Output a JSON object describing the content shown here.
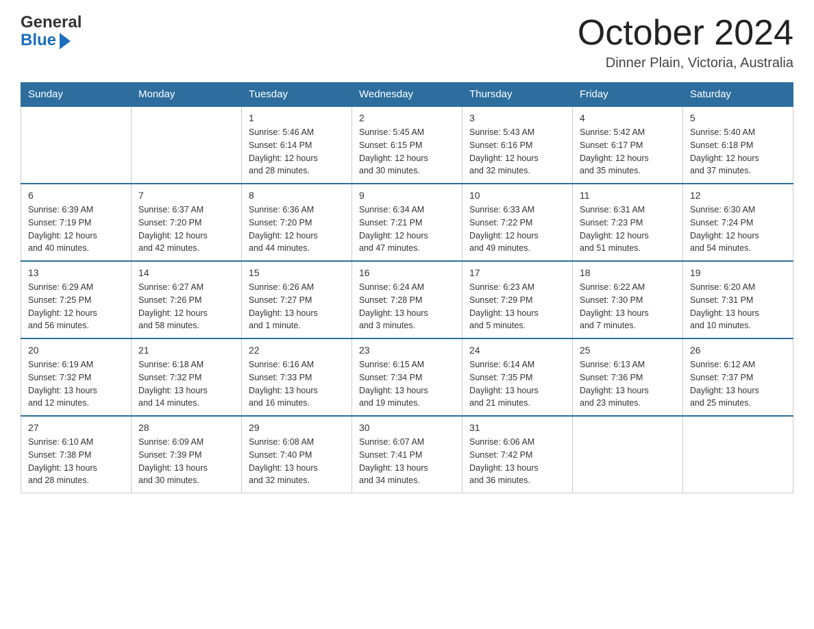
{
  "logo": {
    "text_general": "General",
    "text_blue": "Blue",
    "arrow": "▶"
  },
  "title": "October 2024",
  "location": "Dinner Plain, Victoria, Australia",
  "headers": [
    "Sunday",
    "Monday",
    "Tuesday",
    "Wednesday",
    "Thursday",
    "Friday",
    "Saturday"
  ],
  "weeks": [
    [
      {
        "day": "",
        "info": ""
      },
      {
        "day": "",
        "info": ""
      },
      {
        "day": "1",
        "info": "Sunrise: 5:46 AM\nSunset: 6:14 PM\nDaylight: 12 hours\nand 28 minutes."
      },
      {
        "day": "2",
        "info": "Sunrise: 5:45 AM\nSunset: 6:15 PM\nDaylight: 12 hours\nand 30 minutes."
      },
      {
        "day": "3",
        "info": "Sunrise: 5:43 AM\nSunset: 6:16 PM\nDaylight: 12 hours\nand 32 minutes."
      },
      {
        "day": "4",
        "info": "Sunrise: 5:42 AM\nSunset: 6:17 PM\nDaylight: 12 hours\nand 35 minutes."
      },
      {
        "day": "5",
        "info": "Sunrise: 5:40 AM\nSunset: 6:18 PM\nDaylight: 12 hours\nand 37 minutes."
      }
    ],
    [
      {
        "day": "6",
        "info": "Sunrise: 6:39 AM\nSunset: 7:19 PM\nDaylight: 12 hours\nand 40 minutes."
      },
      {
        "day": "7",
        "info": "Sunrise: 6:37 AM\nSunset: 7:20 PM\nDaylight: 12 hours\nand 42 minutes."
      },
      {
        "day": "8",
        "info": "Sunrise: 6:36 AM\nSunset: 7:20 PM\nDaylight: 12 hours\nand 44 minutes."
      },
      {
        "day": "9",
        "info": "Sunrise: 6:34 AM\nSunset: 7:21 PM\nDaylight: 12 hours\nand 47 minutes."
      },
      {
        "day": "10",
        "info": "Sunrise: 6:33 AM\nSunset: 7:22 PM\nDaylight: 12 hours\nand 49 minutes."
      },
      {
        "day": "11",
        "info": "Sunrise: 6:31 AM\nSunset: 7:23 PM\nDaylight: 12 hours\nand 51 minutes."
      },
      {
        "day": "12",
        "info": "Sunrise: 6:30 AM\nSunset: 7:24 PM\nDaylight: 12 hours\nand 54 minutes."
      }
    ],
    [
      {
        "day": "13",
        "info": "Sunrise: 6:29 AM\nSunset: 7:25 PM\nDaylight: 12 hours\nand 56 minutes."
      },
      {
        "day": "14",
        "info": "Sunrise: 6:27 AM\nSunset: 7:26 PM\nDaylight: 12 hours\nand 58 minutes."
      },
      {
        "day": "15",
        "info": "Sunrise: 6:26 AM\nSunset: 7:27 PM\nDaylight: 13 hours\nand 1 minute."
      },
      {
        "day": "16",
        "info": "Sunrise: 6:24 AM\nSunset: 7:28 PM\nDaylight: 13 hours\nand 3 minutes."
      },
      {
        "day": "17",
        "info": "Sunrise: 6:23 AM\nSunset: 7:29 PM\nDaylight: 13 hours\nand 5 minutes."
      },
      {
        "day": "18",
        "info": "Sunrise: 6:22 AM\nSunset: 7:30 PM\nDaylight: 13 hours\nand 7 minutes."
      },
      {
        "day": "19",
        "info": "Sunrise: 6:20 AM\nSunset: 7:31 PM\nDaylight: 13 hours\nand 10 minutes."
      }
    ],
    [
      {
        "day": "20",
        "info": "Sunrise: 6:19 AM\nSunset: 7:32 PM\nDaylight: 13 hours\nand 12 minutes."
      },
      {
        "day": "21",
        "info": "Sunrise: 6:18 AM\nSunset: 7:32 PM\nDaylight: 13 hours\nand 14 minutes."
      },
      {
        "day": "22",
        "info": "Sunrise: 6:16 AM\nSunset: 7:33 PM\nDaylight: 13 hours\nand 16 minutes."
      },
      {
        "day": "23",
        "info": "Sunrise: 6:15 AM\nSunset: 7:34 PM\nDaylight: 13 hours\nand 19 minutes."
      },
      {
        "day": "24",
        "info": "Sunrise: 6:14 AM\nSunset: 7:35 PM\nDaylight: 13 hours\nand 21 minutes."
      },
      {
        "day": "25",
        "info": "Sunrise: 6:13 AM\nSunset: 7:36 PM\nDaylight: 13 hours\nand 23 minutes."
      },
      {
        "day": "26",
        "info": "Sunrise: 6:12 AM\nSunset: 7:37 PM\nDaylight: 13 hours\nand 25 minutes."
      }
    ],
    [
      {
        "day": "27",
        "info": "Sunrise: 6:10 AM\nSunset: 7:38 PM\nDaylight: 13 hours\nand 28 minutes."
      },
      {
        "day": "28",
        "info": "Sunrise: 6:09 AM\nSunset: 7:39 PM\nDaylight: 13 hours\nand 30 minutes."
      },
      {
        "day": "29",
        "info": "Sunrise: 6:08 AM\nSunset: 7:40 PM\nDaylight: 13 hours\nand 32 minutes."
      },
      {
        "day": "30",
        "info": "Sunrise: 6:07 AM\nSunset: 7:41 PM\nDaylight: 13 hours\nand 34 minutes."
      },
      {
        "day": "31",
        "info": "Sunrise: 6:06 AM\nSunset: 7:42 PM\nDaylight: 13 hours\nand 36 minutes."
      },
      {
        "day": "",
        "info": ""
      },
      {
        "day": "",
        "info": ""
      }
    ]
  ]
}
